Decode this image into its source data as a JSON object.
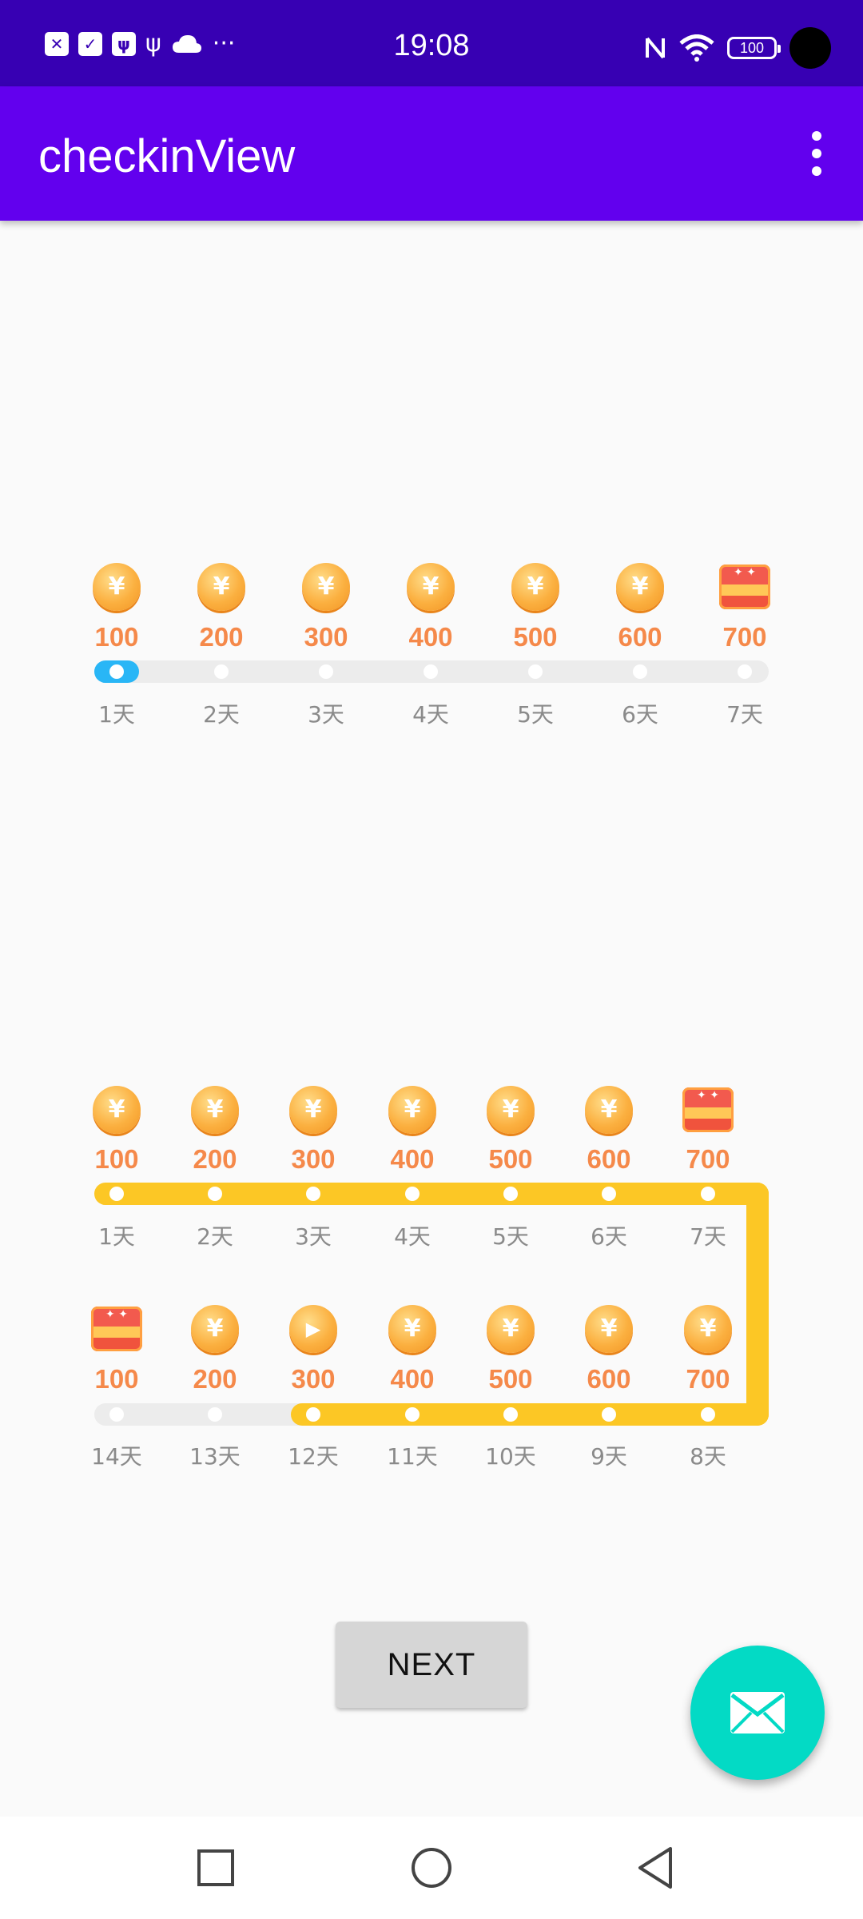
{
  "status_bar": {
    "time": "19:08",
    "battery": "100",
    "left_icons": [
      "x-app-icon",
      "check-icon",
      "usb-debug-icon",
      "usb-icon",
      "cloud-icon",
      "more-dots-icon"
    ],
    "right_icons": [
      "nfc-icon",
      "wifi-icon",
      "battery-icon"
    ]
  },
  "app_bar": {
    "title": "checkinView",
    "menu_icon": "overflow-menu-icon"
  },
  "checkin_single": {
    "rewards": [
      "100",
      "200",
      "300",
      "400",
      "500",
      "600",
      "700"
    ],
    "days": [
      "1天",
      "2天",
      "3天",
      "4天",
      "5天",
      "6天",
      "7天"
    ],
    "icons": [
      "coin",
      "coin",
      "coin",
      "coin",
      "coin",
      "coin",
      "chest"
    ],
    "progress": 1,
    "accent": "#29b6f6"
  },
  "checkin_double": {
    "row1": {
      "rewards": [
        "100",
        "200",
        "300",
        "400",
        "500",
        "600",
        "700"
      ],
      "days": [
        "1天",
        "2天",
        "3天",
        "4天",
        "5天",
        "6天",
        "7天"
      ],
      "icons": [
        "coin",
        "coin",
        "coin",
        "coin",
        "coin",
        "coin",
        "chest"
      ]
    },
    "row2": {
      "rewards": [
        "100",
        "200",
        "300",
        "400",
        "500",
        "600",
        "700"
      ],
      "days": [
        "14天",
        "13天",
        "12天",
        "11天",
        "10天",
        "9天",
        "8天"
      ],
      "icons": [
        "chest",
        "coin",
        "play",
        "coin",
        "coin",
        "coin",
        "coin"
      ]
    },
    "progress": 12,
    "accent": "#fcc725"
  },
  "next_button": {
    "label": "NEXT"
  },
  "fab": {
    "icon": "mail-icon"
  },
  "nav_bar": {
    "icons": [
      "recents-square-icon",
      "home-circle-icon",
      "back-triangle-icon"
    ]
  }
}
